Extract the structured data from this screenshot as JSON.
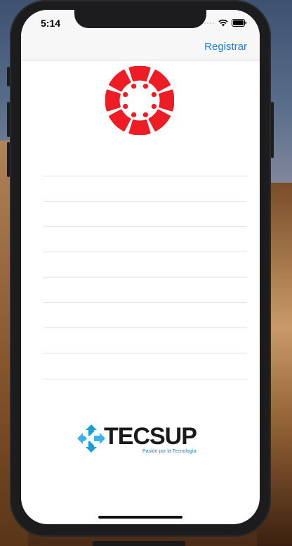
{
  "status_bar": {
    "time": "5:14"
  },
  "navbar": {
    "register_label": "Registrar"
  },
  "form": {
    "fields": [
      "",
      "",
      "",
      "",
      "",
      "",
      "",
      ""
    ]
  },
  "footer_logo": {
    "brand": "TECSUP",
    "tagline": "Pasión por la Tecnología"
  },
  "colors": {
    "accent": "#1a7ee0",
    "canvas_red": "#ee1c25",
    "tecsup_blue": "#1a9fd4"
  },
  "icons": [
    "wifi-icon",
    "battery-icon",
    "cellular-icon",
    "canvas-logo-icon",
    "tecsup-logo-icon"
  ]
}
